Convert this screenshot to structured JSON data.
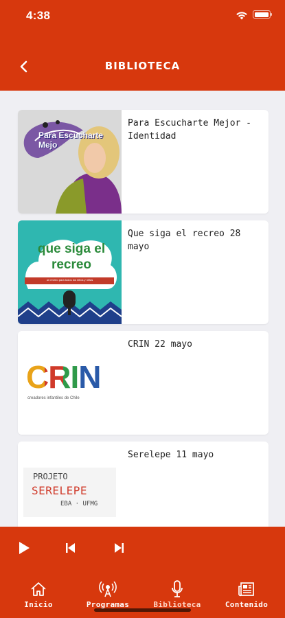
{
  "status": {
    "time": "4:38"
  },
  "header": {
    "title": "BIBLIOTECA"
  },
  "items": [
    {
      "title": "Para Escucharte Mejor - Identidad",
      "art_text": "Para Escucharte Mejo"
    },
    {
      "title": "Que siga el recreo 28 mayo",
      "art_text": "que siga el recreo",
      "art_subtext": "un recreo para todos los niños y niñas"
    },
    {
      "title": "CRIN 22 mayo",
      "art_text": "CRIN",
      "art_subtext": "creadores infantiles de Chile"
    },
    {
      "title": "Serelepe 11 mayo",
      "art_text": "PROJETO",
      "art_text2": "SERELEPE",
      "art_subtext": "EBA · UFMG"
    }
  ],
  "tabs": [
    {
      "label": "Inicio",
      "icon": "home-icon"
    },
    {
      "label": "Programas",
      "icon": "radio-icon"
    },
    {
      "label": "Biblioteca",
      "icon": "microphone-icon"
    },
    {
      "label": "Contenido",
      "icon": "newspaper-icon"
    }
  ],
  "colors": {
    "brand": "#d7380d",
    "background": "#efeff3"
  }
}
